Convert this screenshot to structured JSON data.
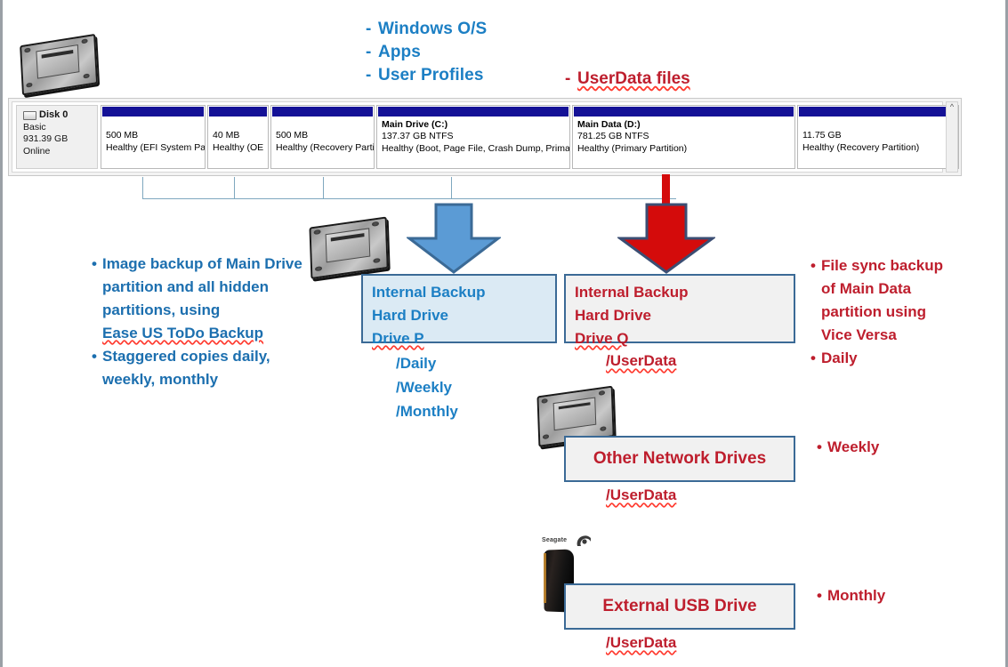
{
  "legend": {
    "blue_items": [
      "Windows O/S",
      "Apps",
      "User Profiles"
    ],
    "red_item": "UserData files",
    "dash": "-"
  },
  "disk_panel": {
    "disk_name": "Disk 0",
    "disk_type": "Basic",
    "disk_size": "931.39 GB",
    "disk_status": "Online",
    "scrollbar_up": "^",
    "partitions": [
      {
        "title": "",
        "size": "500 MB",
        "status": "Healthy (EFI System Par"
      },
      {
        "title": "",
        "size": "40 MB",
        "status": "Healthy (OE\u0001"
      },
      {
        "title": "",
        "size": "500 MB",
        "status": "Healthy (Recovery Parti"
      },
      {
        "title": "Main Drive  (C:)",
        "size": "137.37 GB NTFS",
        "status": "Healthy (Boot, Page File, Crash Dump, Primary"
      },
      {
        "title": "Main Data  (D:)",
        "size": "781.25 GB NTFS",
        "status": "Healthy (Primary Partition)"
      },
      {
        "title": "",
        "size": "11.75 GB",
        "status": "Healthy (Recovery Partition)"
      }
    ]
  },
  "left_notes": {
    "bullet1_line1": "Image backup  of Main Drive",
    "bullet1_line2": "partition and all hidden",
    "bullet1_line3": "partitions, using",
    "bullet1_line4": "Ease US ToDo Backup",
    "bullet2_line1": "Staggered copies daily,",
    "bullet2_line2": "weekly, monthly",
    "bullet": "•"
  },
  "right_notes": {
    "bullet1_line1": "File sync backup",
    "bullet1_line2": "of Main Data",
    "bullet1_line3": "partition using",
    "bullet1_line4": "Vice Versa",
    "bullet2_line1": "Daily",
    "weekly": "Weekly",
    "monthly": "Monthly",
    "bullet": "•"
  },
  "box_p": {
    "line1": "Internal Backup",
    "line2": "Hard Drive",
    "line3": "Drive P",
    "paths": [
      "/Daily",
      "/Weekly",
      "/Monthly"
    ]
  },
  "box_q": {
    "line1": "Internal Backup",
    "line2": "Hard Drive",
    "line3": "Drive Q",
    "path": "/UserData"
  },
  "box_network": {
    "label": "Other Network Drives",
    "path": "/UserData"
  },
  "box_usb": {
    "label": "External USB Drive",
    "path": "/UserData",
    "brand": "Seagate"
  },
  "colors": {
    "blue_text": "#1C7FC4",
    "blue_dark_text": "#1C6FAF",
    "red_text": "#BE1E2D",
    "arrow_blue": "#5B9BD5",
    "arrow_blue_outline": "#3B6A96",
    "arrow_red": "#D40B0B",
    "arrow_red_outline": "#3B4E73",
    "box_border": "#3B6A96",
    "partition_cap": "#141196",
    "connector": "#7FA8BF"
  }
}
